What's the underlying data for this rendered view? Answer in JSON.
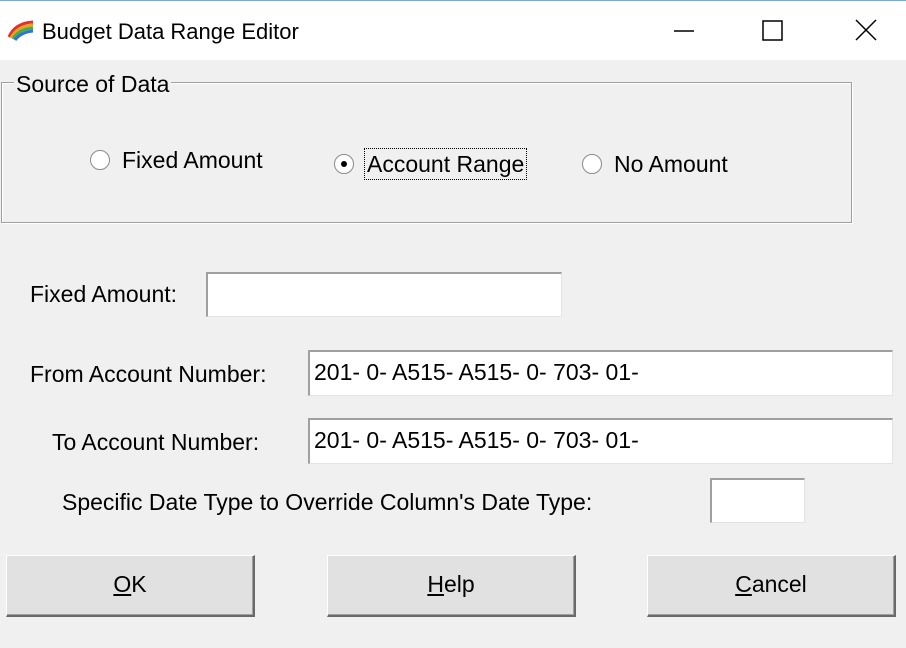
{
  "window": {
    "title": "Budget Data Range Editor",
    "icon": "app-rainbow-icon",
    "controls": {
      "minimize": "minimize-icon",
      "maximize": "maximize-icon",
      "close": "close-icon"
    }
  },
  "source_group": {
    "legend": "Source of Data",
    "options": [
      {
        "label": "Fixed Amount",
        "checked": false
      },
      {
        "label": "Account Range",
        "checked": true
      },
      {
        "label": "No Amount",
        "checked": false
      }
    ]
  },
  "fields": {
    "fixed_amount": {
      "label": "Fixed Amount:",
      "value": ""
    },
    "from_account": {
      "label": "From Account Number:",
      "value": "201- 0- A515- A515- 0- 703- 01-"
    },
    "to_account": {
      "label": "To Account Number:",
      "value": "201- 0- A515- A515- 0- 703- 01-"
    },
    "date_type": {
      "label": "Specific Date Type to Override Column's Date Type:",
      "value": ""
    }
  },
  "buttons": {
    "ok": {
      "mnemonic": "O",
      "rest": "K"
    },
    "help": {
      "mnemonic": "H",
      "rest": "elp"
    },
    "cancel": {
      "mnemonic": "C",
      "rest": "ancel"
    }
  }
}
